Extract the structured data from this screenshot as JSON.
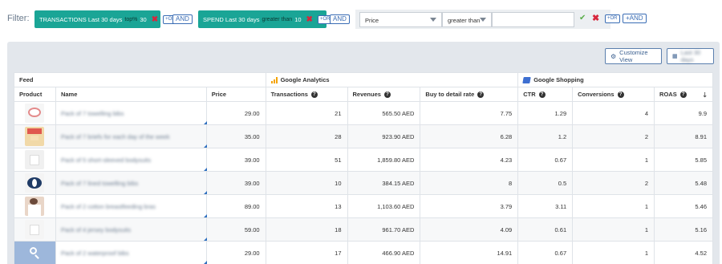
{
  "filter": {
    "label": "Filter:",
    "chips": [
      {
        "metric": "TRANSACTIONS Last 30 days",
        "operator": "top%",
        "value": "30"
      },
      {
        "metric": "SPEND Last 30 days",
        "operator": "greater than",
        "value": "10"
      }
    ],
    "or_label": "+OR",
    "and_label": "AND",
    "builder": {
      "field": "Price",
      "operator": "greater than",
      "value": "",
      "or_label": "+OR",
      "and_label": "+AND"
    }
  },
  "toolbar": {
    "customize_label": "Customize View",
    "date_label": "Last 30 days"
  },
  "groups": {
    "feed": "Feed",
    "ga": "Google Analytics",
    "gs": "Google Shopping"
  },
  "columns": {
    "product": "Product",
    "name": "Name",
    "price": "Price",
    "transactions": "Transactions",
    "revenues": "Revenues",
    "buy_to_detail": "Buy to detail rate",
    "ctr": "CTR",
    "conversions": "Conversions",
    "roas": "ROAS"
  },
  "colors": {
    "chip": "#1aa596",
    "accent": "#3a6db5",
    "ga": "#f4a300",
    "gs": "#3d6fd1"
  },
  "rows": [
    {
      "name": "Pack of 7 towelling bibs",
      "price": "29.00",
      "transactions": "21",
      "revenues": "565.50 AED",
      "buy_to_detail": "7.75",
      "ctr": "1.29",
      "conversions": "4",
      "roas": "9.9"
    },
    {
      "name": "Pack of 7 briefs for each day of the week",
      "price": "35.00",
      "transactions": "28",
      "revenues": "923.90 AED",
      "buy_to_detail": "6.28",
      "ctr": "1.2",
      "conversions": "2",
      "roas": "8.91"
    },
    {
      "name": "Pack of 5 short-sleeved bodysuits",
      "price": "39.00",
      "transactions": "51",
      "revenues": "1,859.80 AED",
      "buy_to_detail": "4.23",
      "ctr": "0.67",
      "conversions": "1",
      "roas": "5.85"
    },
    {
      "name": "Pack of 7 lined towelling bibs",
      "price": "39.00",
      "transactions": "10",
      "revenues": "384.15 AED",
      "buy_to_detail": "8",
      "ctr": "0.5",
      "conversions": "2",
      "roas": "5.48"
    },
    {
      "name": "Pack of 2 cotton breastfeeding bras",
      "price": "89.00",
      "transactions": "13",
      "revenues": "1,103.60 AED",
      "buy_to_detail": "3.79",
      "ctr": "3.11",
      "conversions": "1",
      "roas": "5.46"
    },
    {
      "name": "Pack of 4 jersey bodysuits",
      "price": "59.00",
      "transactions": "18",
      "revenues": "961.70 AED",
      "buy_to_detail": "4.09",
      "ctr": "0.61",
      "conversions": "1",
      "roas": "5.16"
    },
    {
      "name": "Pack of 2 waterproof bibs",
      "price": "29.00",
      "transactions": "17",
      "revenues": "466.90 AED",
      "buy_to_detail": "14.91",
      "ctr": "0.67",
      "conversions": "1",
      "roas": "4.52"
    }
  ]
}
